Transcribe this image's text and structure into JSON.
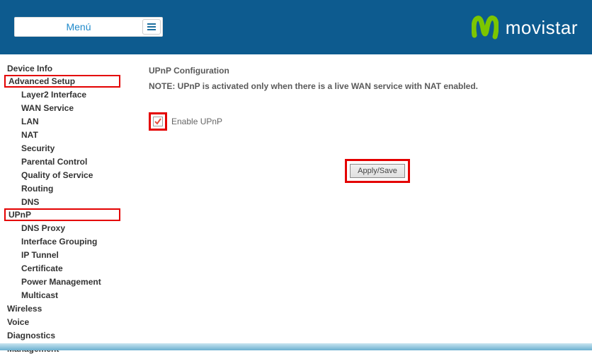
{
  "header": {
    "menu_label": "Menú",
    "brand": "movistar"
  },
  "sidebar": {
    "items": [
      {
        "label": "Device Info",
        "level": 0,
        "highlight": false
      },
      {
        "label": "Advanced Setup",
        "level": 0,
        "highlight": true
      },
      {
        "label": "Layer2 Interface",
        "level": 1,
        "highlight": false
      },
      {
        "label": "WAN Service",
        "level": 1,
        "highlight": false
      },
      {
        "label": "LAN",
        "level": 1,
        "highlight": false
      },
      {
        "label": "NAT",
        "level": 1,
        "highlight": false
      },
      {
        "label": "Security",
        "level": 1,
        "highlight": false
      },
      {
        "label": "Parental Control",
        "level": 1,
        "highlight": false
      },
      {
        "label": "Quality of Service",
        "level": 1,
        "highlight": false
      },
      {
        "label": "Routing",
        "level": 1,
        "highlight": false
      },
      {
        "label": "DNS",
        "level": 1,
        "highlight": false
      },
      {
        "label": "UPnP",
        "level": 1,
        "highlight": true
      },
      {
        "label": "DNS Proxy",
        "level": 1,
        "highlight": false
      },
      {
        "label": "Interface Grouping",
        "level": 1,
        "highlight": false
      },
      {
        "label": "IP Tunnel",
        "level": 1,
        "highlight": false
      },
      {
        "label": "Certificate",
        "level": 1,
        "highlight": false
      },
      {
        "label": "Power Management",
        "level": 1,
        "highlight": false
      },
      {
        "label": "Multicast",
        "level": 1,
        "highlight": false
      },
      {
        "label": "Wireless",
        "level": 0,
        "highlight": false
      },
      {
        "label": "Voice",
        "level": 0,
        "highlight": false
      },
      {
        "label": "Diagnostics",
        "level": 0,
        "highlight": false
      },
      {
        "label": "Management",
        "level": 0,
        "highlight": false
      }
    ]
  },
  "main": {
    "title": "UPnP Configuration",
    "note": "NOTE: UPnP is activated only when there is a live WAN service with NAT enabled.",
    "enable_label": "Enable UPnP",
    "enable_checked": true,
    "apply_label": "Apply/Save"
  }
}
